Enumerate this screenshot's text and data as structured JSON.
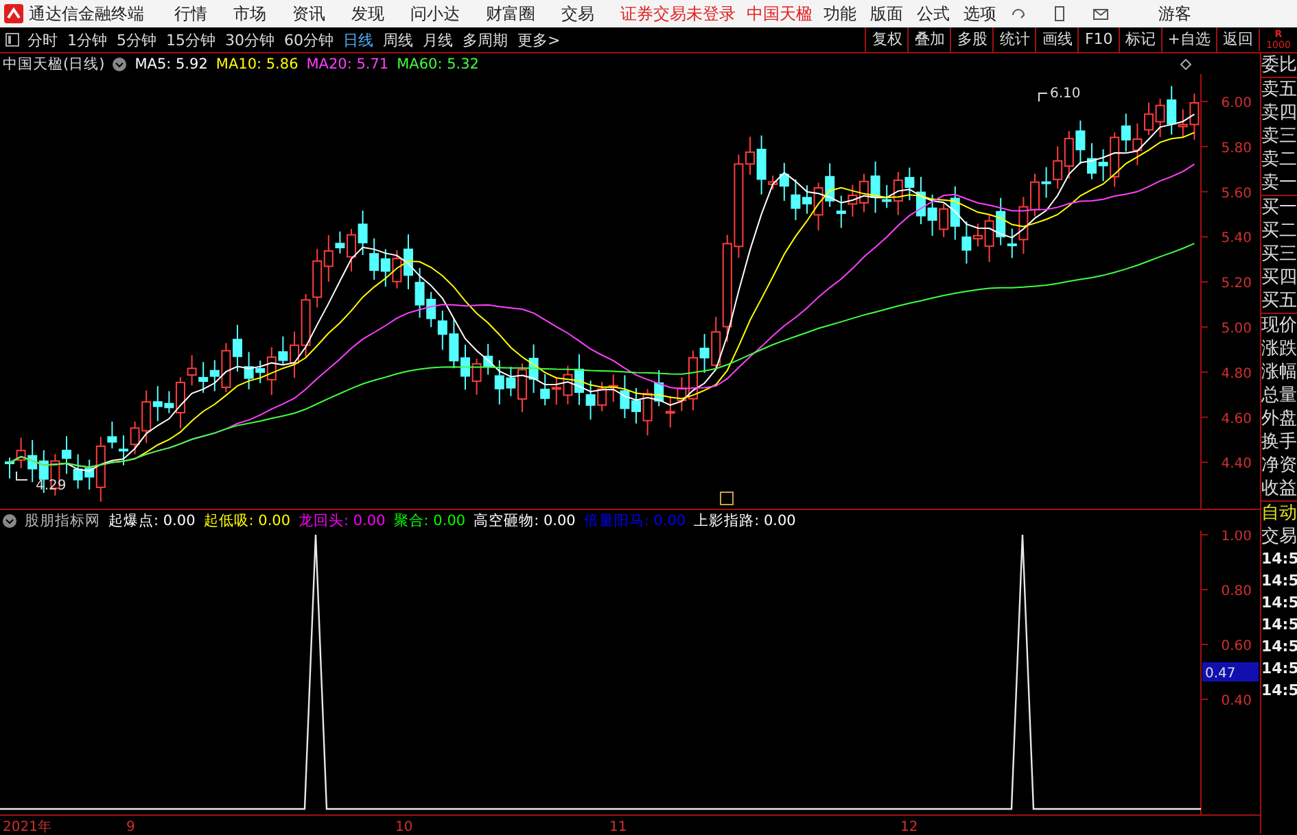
{
  "app": {
    "title": "通达信金融终端",
    "menus": [
      "行情",
      "市场",
      "资讯",
      "发现",
      "问小达",
      "财富圈",
      "交易"
    ],
    "notices": [
      "证券交易未登录",
      "中国天楹"
    ],
    "right_menus": [
      "功能",
      "版面",
      "公式",
      "选项"
    ],
    "user": "游客"
  },
  "toolbar": {
    "periods": [
      {
        "label": "分时",
        "selected": false
      },
      {
        "label": "1分钟",
        "selected": false
      },
      {
        "label": "5分钟",
        "selected": false
      },
      {
        "label": "15分钟",
        "selected": false
      },
      {
        "label": "30分钟",
        "selected": false
      },
      {
        "label": "60分钟",
        "selected": false
      },
      {
        "label": "日线",
        "selected": true
      },
      {
        "label": "周线",
        "selected": false
      },
      {
        "label": "月线",
        "selected": false
      },
      {
        "label": "多周期",
        "selected": false
      },
      {
        "label": "更多>",
        "selected": false
      }
    ],
    "buttons": [
      "复权",
      "叠加",
      "多股",
      "统计",
      "画线",
      "F10",
      "标记",
      "+自选",
      "返回"
    ]
  },
  "main_chart": {
    "title": "中国天楹(日线)",
    "ma": [
      {
        "label": "MA5:",
        "value": "5.92",
        "color": "#ffffff"
      },
      {
        "label": "MA10:",
        "value": "5.86",
        "color": "#ffff00"
      },
      {
        "label": "MA20:",
        "value": "5.71",
        "color": "#ff40ff"
      },
      {
        "label": "MA60:",
        "value": "5.32",
        "color": "#40ff40"
      }
    ],
    "y_axis": [
      "6.00",
      "5.80",
      "5.60",
      "5.40",
      "5.20",
      "5.00",
      "4.80",
      "4.60",
      "4.40"
    ],
    "high_label": "6.10",
    "low_label": "4.29"
  },
  "indicator": {
    "name": "股朋指标网",
    "items": [
      {
        "label": "起爆点:",
        "value": "0.00",
        "color": "#ffffff"
      },
      {
        "label": "起低吸:",
        "value": "0.00",
        "color": "#ffff00"
      },
      {
        "label": "龙回头:",
        "value": "0.00",
        "color": "#ff00ff"
      },
      {
        "label": "聚合:",
        "value": "0.00",
        "color": "#00ff00"
      },
      {
        "label": "高空砸物:",
        "value": "0.00",
        "color": "#ffffff"
      },
      {
        "label": "倍量阳马:",
        "value": "0.00",
        "color": "#0000ff"
      },
      {
        "label": "上影指路:",
        "value": "0.00",
        "color": "#ffffff"
      }
    ],
    "y_axis": [
      "1.00",
      "0.80",
      "0.60",
      "0.40"
    ],
    "current_reading": "0.47"
  },
  "x_axis": [
    "2021年",
    "9",
    "10",
    "11",
    "12"
  ],
  "side_panel": {
    "header": [
      "R",
      "1000"
    ],
    "quote_labels": [
      "委比",
      "卖五",
      "卖四",
      "卖三",
      "卖二",
      "卖一",
      "买一",
      "买二",
      "买三",
      "买四",
      "买五",
      "现价",
      "涨跌",
      "涨幅",
      "总量",
      "外盘",
      "换手",
      "净资",
      "收益"
    ],
    "trade_labels": [
      {
        "label": "自动",
        "kind": "highlight"
      },
      {
        "label": "交易",
        "kind": "plain"
      }
    ],
    "times": [
      "14:5",
      "14:5",
      "14:5",
      "14:5",
      "14:5",
      "14:5",
      "14:5"
    ]
  }
}
